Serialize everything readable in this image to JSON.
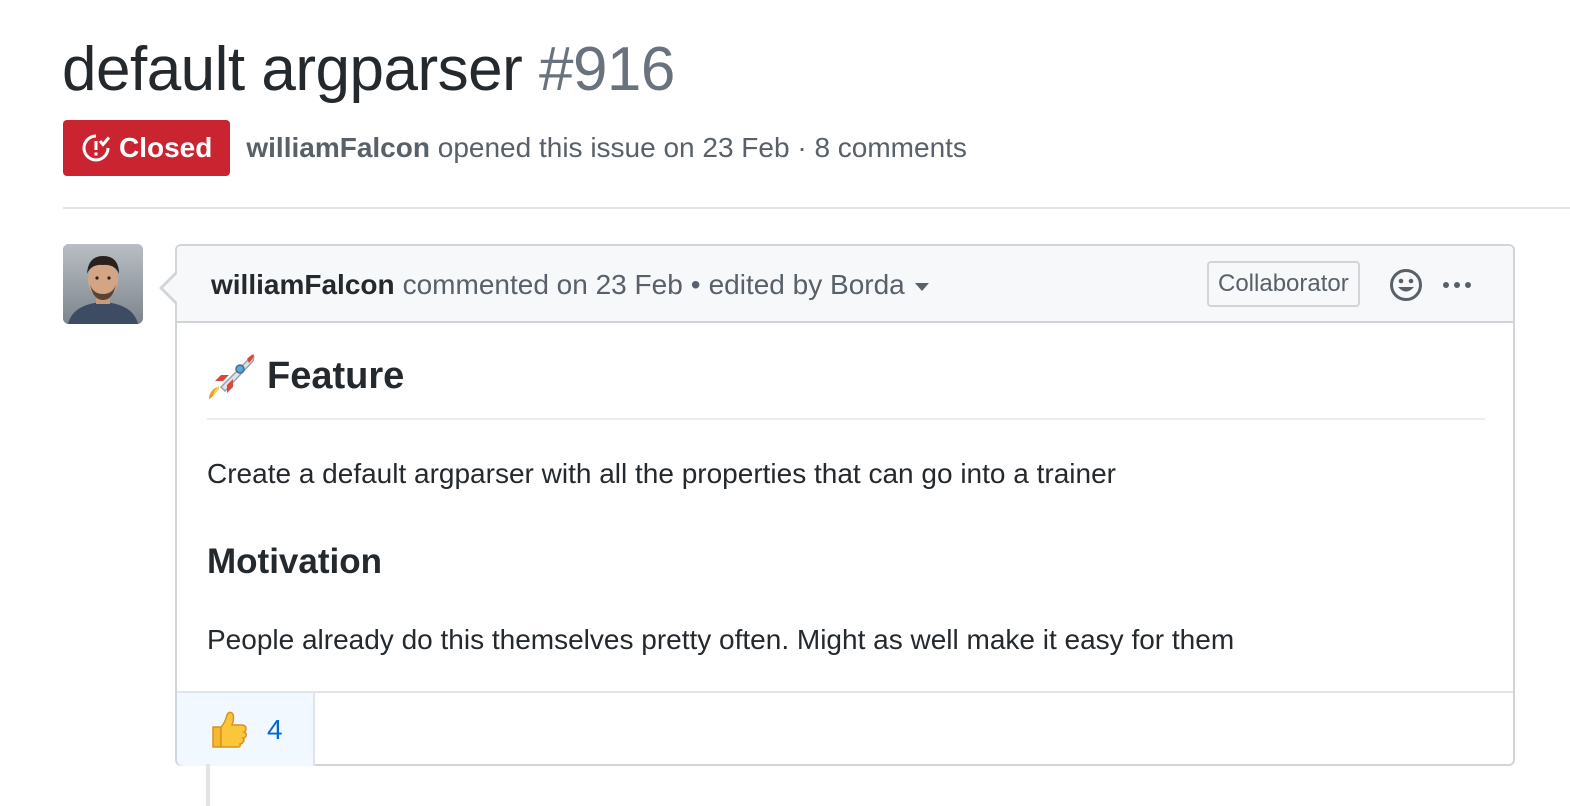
{
  "issue": {
    "title": "default argparser",
    "number": "#916",
    "state": "Closed",
    "author": "williamFalcon",
    "opened_text": "opened this issue on 23 Feb · 8 comments"
  },
  "comment": {
    "author": "williamFalcon",
    "action": "commented on 23 Feb",
    "separator": "•",
    "edited_text": "edited by Borda",
    "role_badge": "Collaborator",
    "body": {
      "heading_feature": "Feature",
      "paragraph_1": "Create a default argparser with all the properties that can go into a trainer",
      "heading_motivation": "Motivation",
      "paragraph_2": "People already do this themselves pretty often. Might as well make it easy for them"
    },
    "reactions": [
      {
        "icon": "thumbs-up-icon",
        "count": "4"
      }
    ]
  },
  "colors": {
    "closed_red": "#cb2431",
    "link_blue": "#0366d6",
    "muted_gray": "#586069"
  }
}
